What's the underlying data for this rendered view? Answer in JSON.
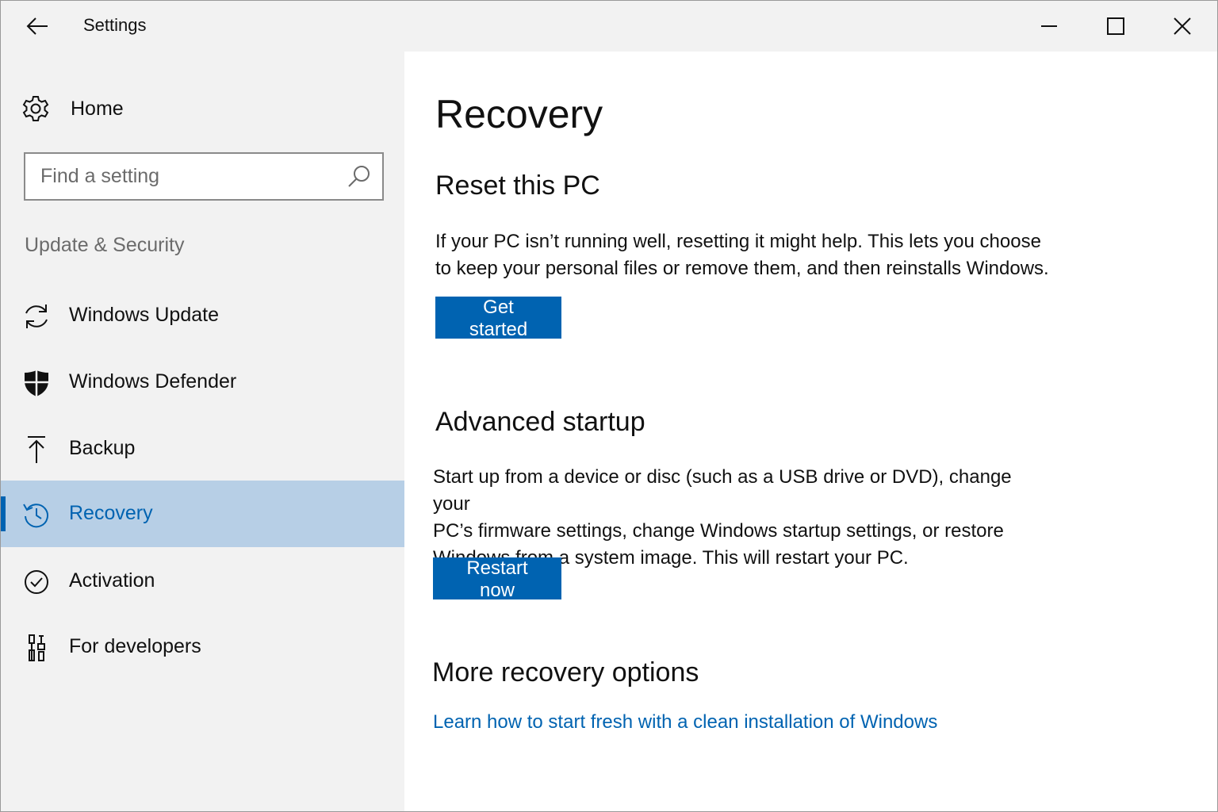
{
  "window": {
    "title": "Settings",
    "controls": {
      "back_icon": "back-arrow-icon",
      "minimize_icon": "minimize-icon",
      "maximize_icon": "maximize-icon",
      "close_icon": "close-icon"
    }
  },
  "sidebar": {
    "home": {
      "label": "Home",
      "icon": "gear-icon"
    },
    "search": {
      "placeholder": "Find a setting",
      "value": "",
      "icon": "search-icon"
    },
    "section_label": "Update & Security",
    "items": [
      {
        "label": "Windows Update",
        "icon": "sync-icon",
        "selected": false
      },
      {
        "label": "Windows Defender",
        "icon": "shield-icon",
        "selected": false
      },
      {
        "label": "Backup",
        "icon": "upload-arrow-icon",
        "selected": false
      },
      {
        "label": "Recovery",
        "icon": "history-icon",
        "selected": true
      },
      {
        "label": "Activation",
        "icon": "check-circle-icon",
        "selected": false
      },
      {
        "label": "For developers",
        "icon": "developer-tools-icon",
        "selected": false
      }
    ]
  },
  "main": {
    "title": "Recovery",
    "reset": {
      "heading": "Reset this PC",
      "description_line1": "If your PC isn’t running well, resetting it might help. This lets you choose",
      "description_line2": "to keep your personal files or remove them, and then reinstalls Windows.",
      "button_label": "Get started"
    },
    "advanced": {
      "heading": "Advanced startup",
      "description_line1": "Start up from a device or disc (such as a USB drive or DVD), change your",
      "description_line2": "PC’s firmware settings, change Windows startup settings, or restore",
      "description_line3": "Windows from a system image. This will restart your PC.",
      "button_label": "Restart now"
    },
    "more": {
      "heading": "More recovery options",
      "link_text": "Learn how to start fresh with a clean installation of Windows"
    }
  },
  "colors": {
    "accent": "#0063b1",
    "selected_background": "#b7cfe6",
    "sidebar_background": "#f2f2f2",
    "content_background": "#ffffff"
  }
}
